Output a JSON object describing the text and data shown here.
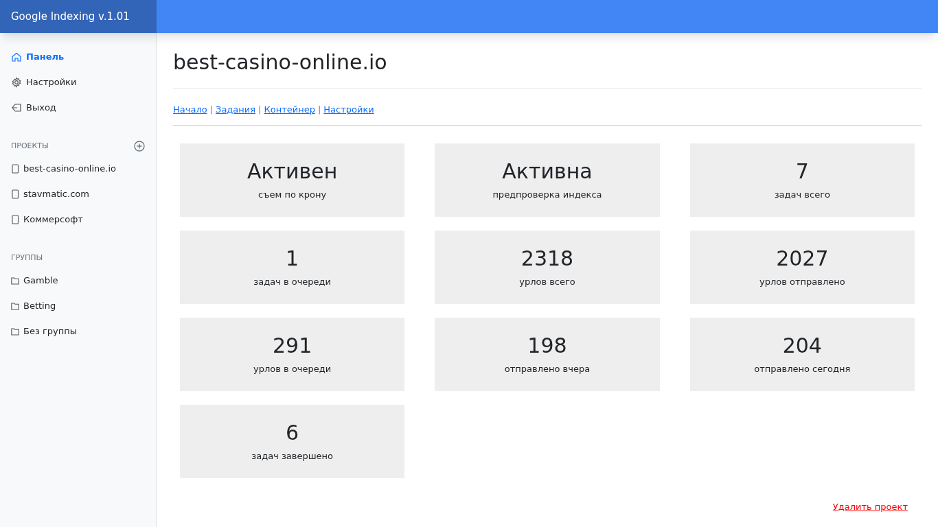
{
  "header": {
    "title": "Google Indexing v.1.01"
  },
  "sidebar": {
    "nav": [
      {
        "label": "Панель",
        "kind": "home",
        "selected": true
      },
      {
        "label": "Настройки",
        "kind": "settings",
        "selected": false
      },
      {
        "label": "Выход",
        "kind": "exit",
        "selected": false
      }
    ],
    "projects": {
      "heading": "ПРОЕКТЫ",
      "items": [
        {
          "label": "best-casino-online.io"
        },
        {
          "label": "stavmatic.com"
        },
        {
          "label": "Коммерсофт"
        }
      ]
    },
    "groups": {
      "heading": "ГРУППЫ",
      "items": [
        {
          "label": "Gamble"
        },
        {
          "label": "Betting"
        },
        {
          "label": "Без группы"
        }
      ]
    }
  },
  "main": {
    "title": "best-casino-online.io",
    "nav": [
      {
        "kind": "link",
        "text": "Начало"
      },
      {
        "kind": "separator",
        "text": "|"
      },
      {
        "kind": "link",
        "text": "Задания"
      },
      {
        "kind": "separator",
        "text": "|"
      },
      {
        "kind": "link",
        "text": "Контейнер"
      },
      {
        "kind": "separator",
        "text": "|"
      },
      {
        "kind": "link",
        "text": "Настройки"
      }
    ],
    "cards": [
      {
        "value": "Активен",
        "label": "съем по крону"
      },
      {
        "value": "Активна",
        "label": "предпроверка индекса"
      },
      {
        "value": "7",
        "label": "задач всего"
      },
      {
        "value": "1",
        "label": "задач в очереди"
      },
      {
        "value": "2318",
        "label": "урлов всего"
      },
      {
        "value": "2027",
        "label": "урлов отправлено"
      },
      {
        "value": "291",
        "label": "урлов в очереди"
      },
      {
        "value": "198",
        "label": "отправлено вчера"
      },
      {
        "value": "204",
        "label": "отправлено сегодня"
      },
      {
        "value": "6",
        "label": "задач завершено"
      }
    ],
    "delete_link": "Удалить проект"
  }
}
